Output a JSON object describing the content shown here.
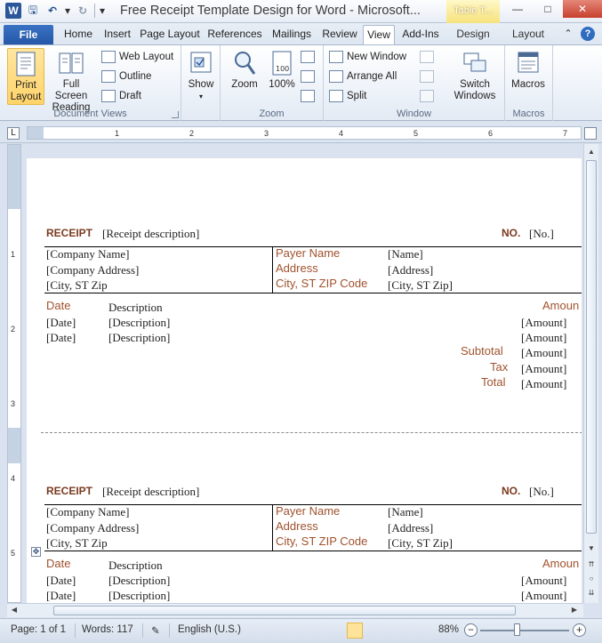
{
  "app": {
    "title": "Free Receipt Template Design for Word  -  Microsoft...",
    "context_tab_group": "Table T..."
  },
  "tabs": {
    "file": "File",
    "home": "Home",
    "insert": "Insert",
    "page_layout": "Page Layout",
    "references": "References",
    "mailings": "Mailings",
    "review": "Review",
    "view": "View",
    "addins": "Add-Ins",
    "design": "Design",
    "layout": "Layout"
  },
  "ribbon": {
    "document_views": {
      "label": "Document Views",
      "print_layout": "Print Layout",
      "full_screen_reading": "Full Screen Reading",
      "web_layout": "Web Layout",
      "outline": "Outline",
      "draft": "Draft"
    },
    "show": {
      "label": "Show"
    },
    "zoom": {
      "label": "Zoom",
      "zoom": "Zoom",
      "hundred": "100%"
    },
    "window": {
      "label": "Window",
      "new_window": "New Window",
      "arrange_all": "Arrange All",
      "split": "Split",
      "switch_windows": "Switch Windows"
    },
    "macros": {
      "label": "Macros",
      "macros": "Macros"
    }
  },
  "ruler": {
    "h_marks": [
      "1",
      "2",
      "3",
      "4",
      "5",
      "6",
      "7"
    ],
    "v_marks": [
      "1",
      "2",
      "3",
      "4",
      "5"
    ]
  },
  "receipt": {
    "title": "RECEIPT",
    "description": "[Receipt description]",
    "no_label": "NO.",
    "no_value": "[No.]",
    "company_name": "[Company Name]",
    "company_address": "[Company Address]",
    "company_city": "[City, ST  Zip",
    "payer_name_label": "Payer Name",
    "address_label": "Address",
    "city_label": "City, ST ZIP Code",
    "name_value": "[Name]",
    "address_value": "[Address]",
    "city_value": "[City, ST  Zip]",
    "date_header": "Date",
    "description_header": "Description",
    "amount_header": "Amoun",
    "date_value": "[Date]",
    "desc_value": "[Description]",
    "amount_value": "[Amount]",
    "subtotal": "Subtotal",
    "tax": "Tax",
    "total": "Total"
  },
  "status": {
    "page": "Page: 1 of 1",
    "words": "Words: 117",
    "language": "English (U.S.)",
    "zoom": "88%"
  },
  "colors": {
    "label_brown": "#a0522d",
    "title_brown": "#7a3a1e",
    "file_tab": "#2557a6"
  }
}
